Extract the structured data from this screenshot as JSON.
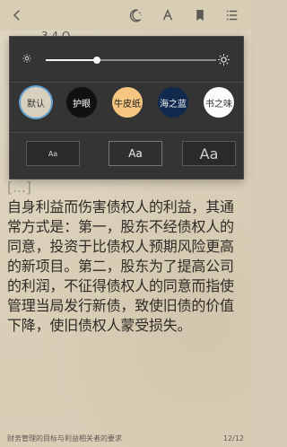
{
  "topbar": {
    "icons": {
      "back": "back-arrow-icon",
      "night": "moon-stars-icon",
      "font": "font-icon",
      "bookmark": "bookmark-icon",
      "menu": "menu-icon"
    }
  },
  "book": {
    "partial_header": "3.4 Q"
  },
  "settings": {
    "brightness_fraction": 0.3,
    "themes": [
      {
        "label": "默认",
        "bg": "#d8d0bf",
        "text": "#333333",
        "selected": true
      },
      {
        "label": "护眼",
        "bg": "#111111",
        "text": "#ffffff",
        "selected": false
      },
      {
        "label": "牛皮纸",
        "bg": "#f4c680",
        "text": "#1b1b1b",
        "selected": false
      },
      {
        "label": "海之蓝",
        "bg": "#10294d",
        "text": "#f5f5f5",
        "selected": false
      },
      {
        "label": "书之味",
        "bg": "#fbfbfb",
        "text": "#333333",
        "selected": false
      }
    ],
    "font_sizes": [
      {
        "label": "Aa"
      },
      {
        "label": "Aa"
      },
      {
        "label": "Aa"
      }
    ]
  },
  "content": {
    "partial_line": "[...]",
    "lines": [
      "自身利益而伤害债权人的利益，其通",
      "常方式是：第一，股东不经债权人的",
      "同意，投资于比债权人预期风险更高",
      "的新项目。第二，股东为了提高公司",
      "的利润，不征得债权人的同意而指使",
      "管理当局发行新债，致使旧债的价值",
      "下降，使旧债权人蒙受损失。"
    ]
  },
  "footer": {
    "chapter": "财务管理的目标与利益相关者的要求",
    "page": "12/12"
  }
}
